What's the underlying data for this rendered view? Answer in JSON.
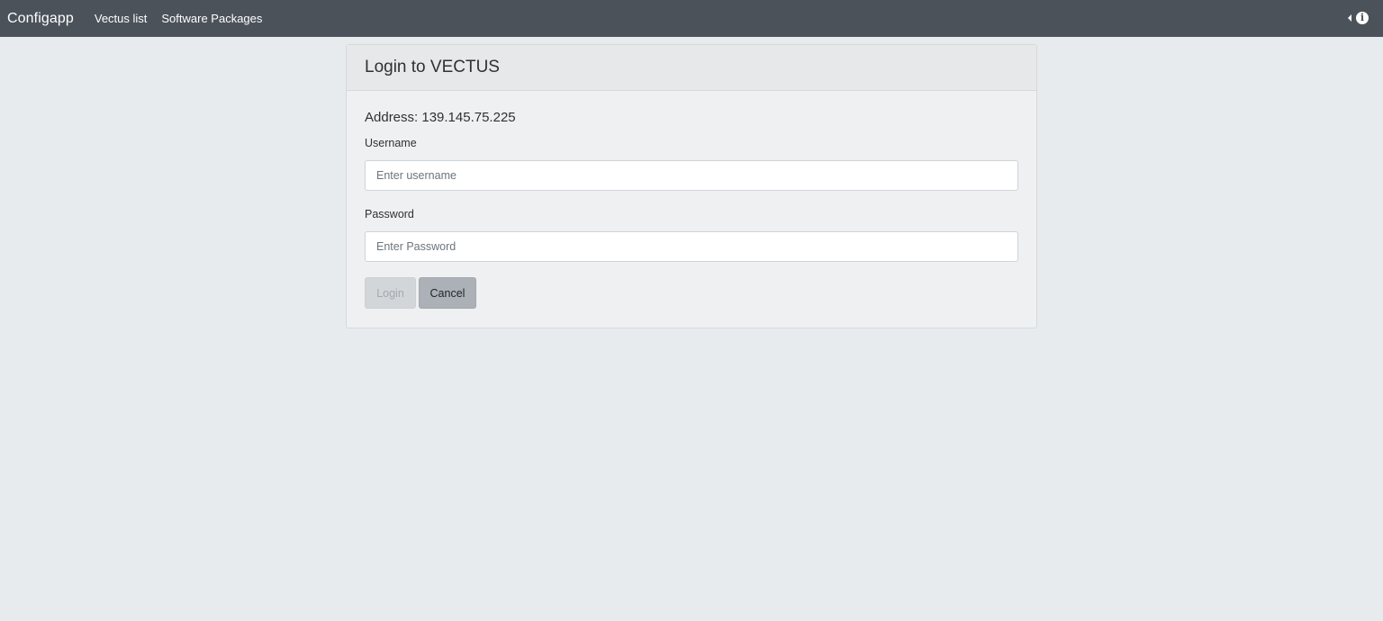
{
  "navbar": {
    "brand": "Configapp",
    "links": [
      {
        "label": "Vectus list"
      },
      {
        "label": "Software Packages"
      }
    ],
    "right_icons": [
      "caret-left-icon",
      "info-icon"
    ],
    "info_glyph": "i"
  },
  "login_card": {
    "title": "Login to VECTUS",
    "address": "Address: 139.145.75.225",
    "username": {
      "label": "Username",
      "placeholder": "Enter username",
      "value": ""
    },
    "password": {
      "label": "Password",
      "placeholder": "Enter Password",
      "value": ""
    },
    "buttons": {
      "login": "Login",
      "cancel": "Cancel"
    }
  },
  "colors": {
    "navbar_bg": "#4b525a",
    "page_bg": "#e8ebee",
    "card_bg": "#eff0f2",
    "cancel_bg": "#abb1b7"
  }
}
